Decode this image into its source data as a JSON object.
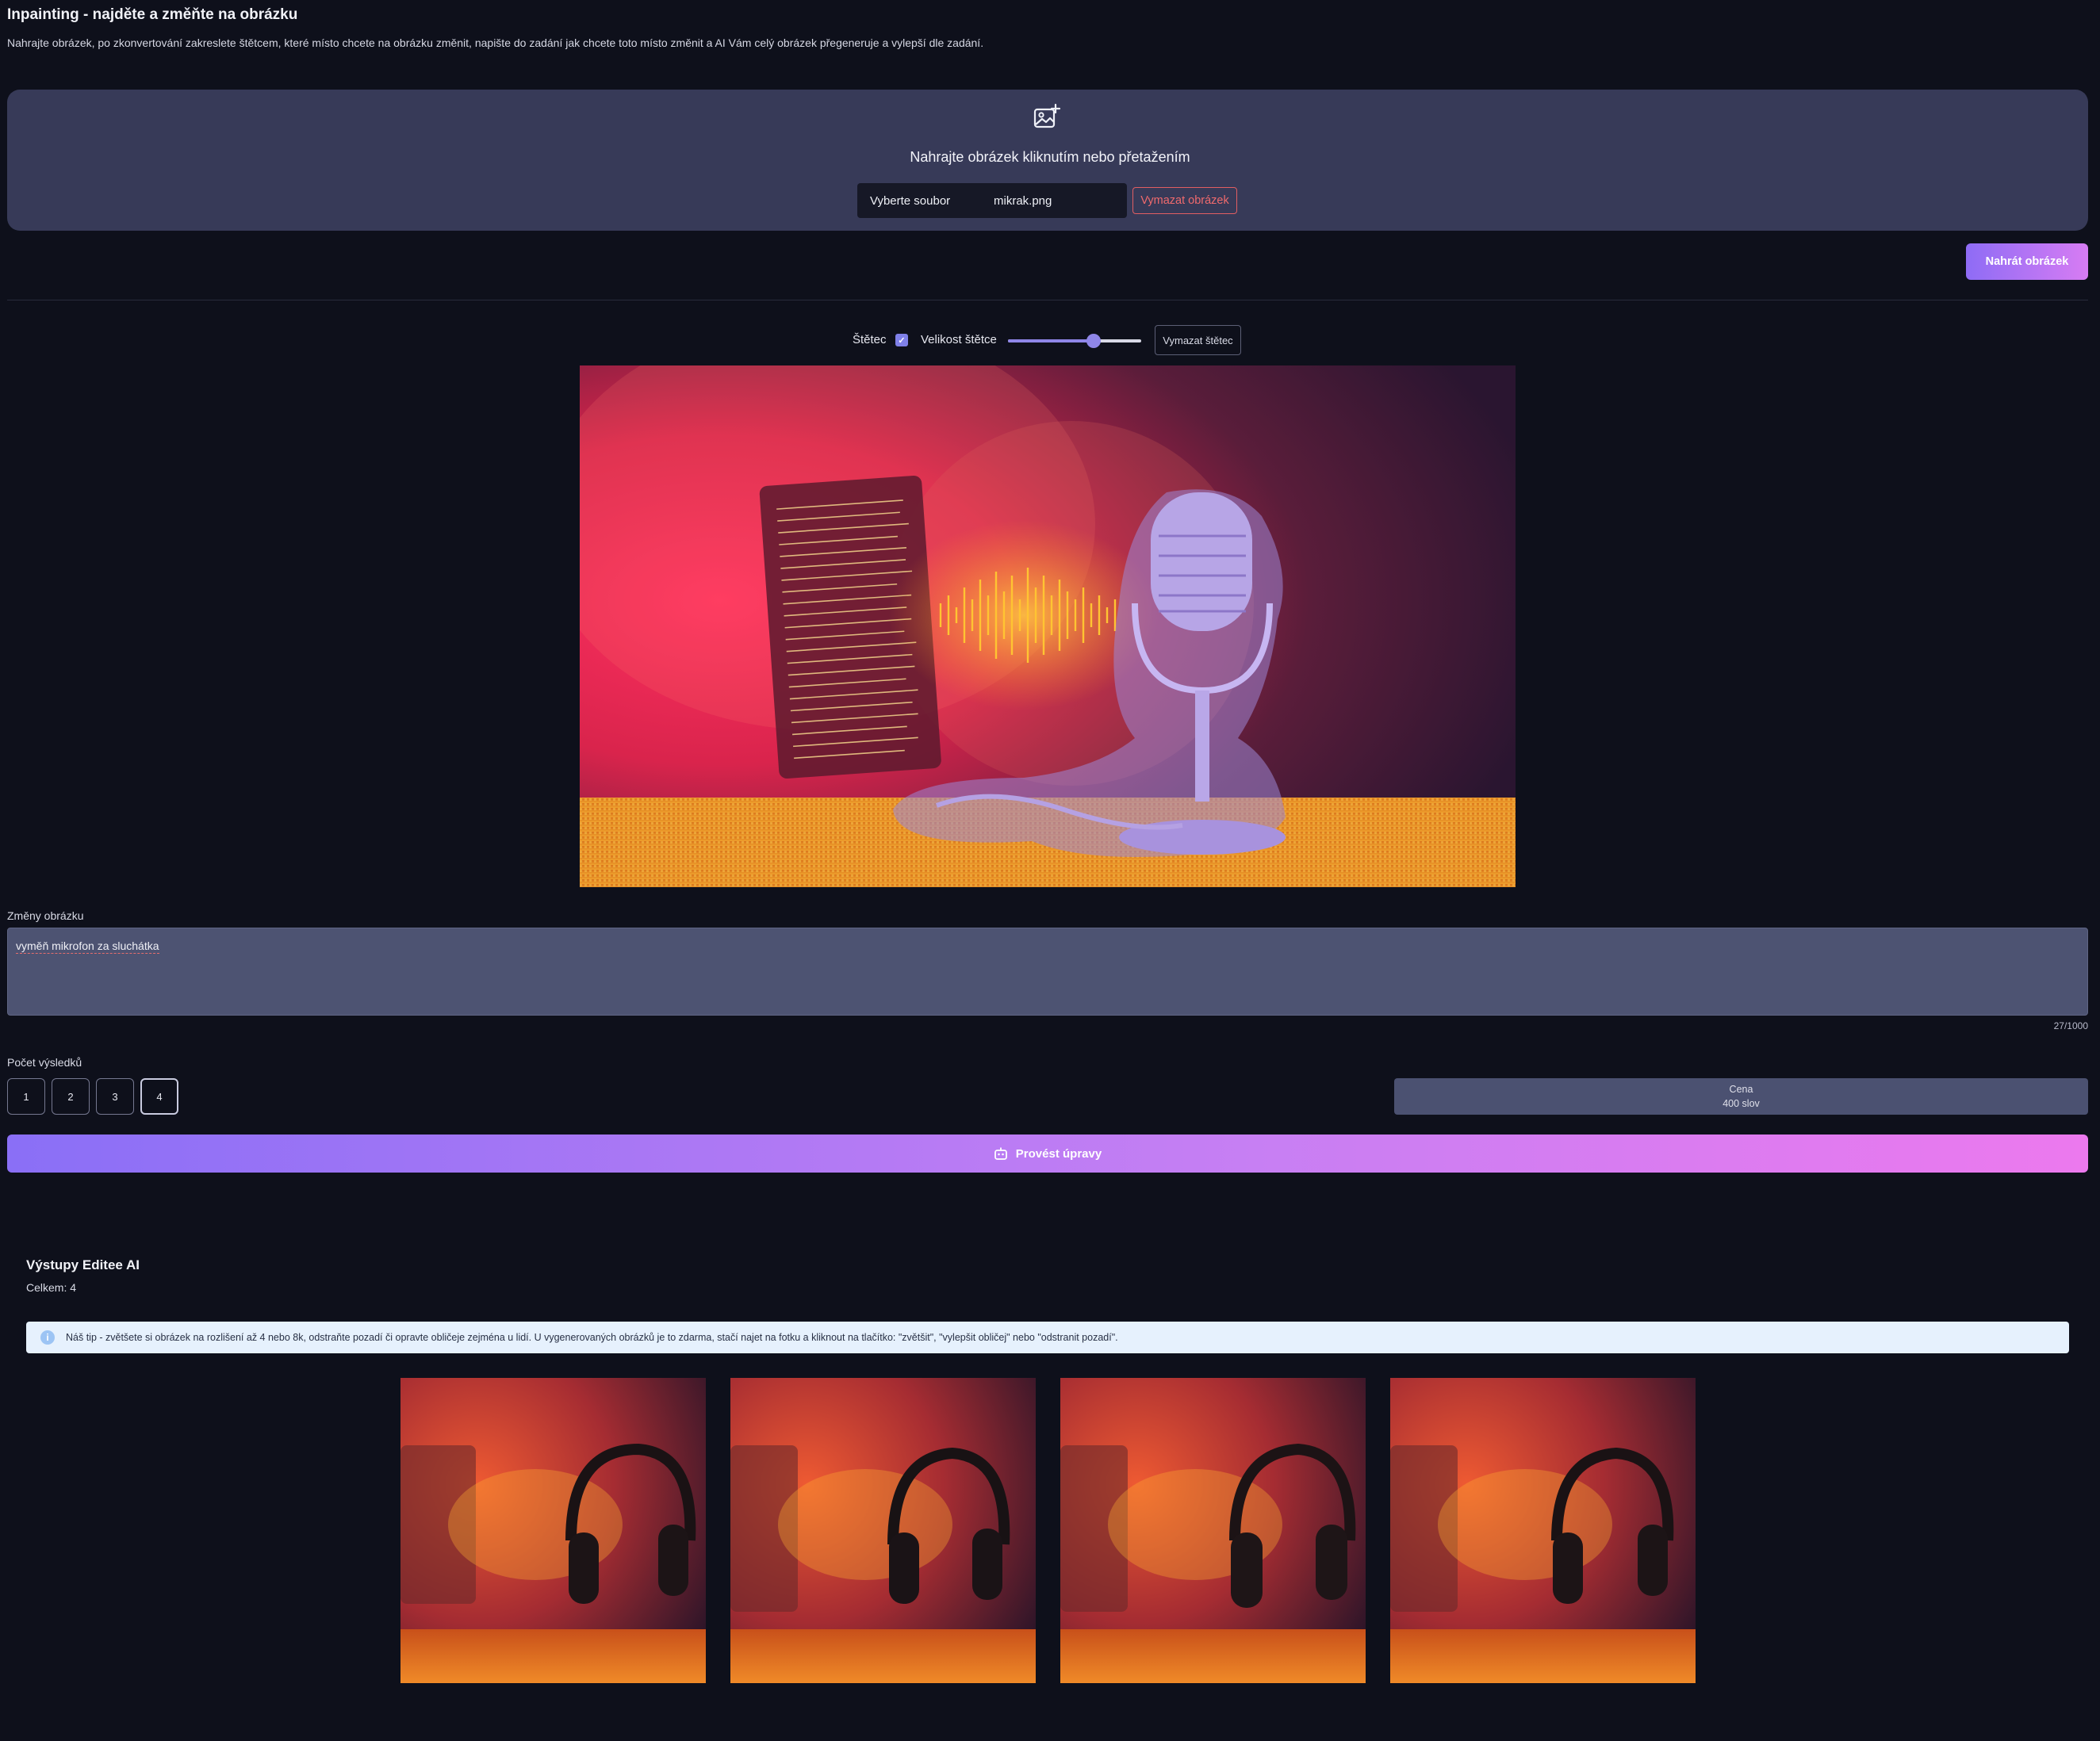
{
  "header": {
    "title": "Inpainting - najděte a změňte na obrázku",
    "description": "Nahrajte obrázek, po zkonvertování zakreslete štětcem, které místo chcete na obrázku změnit, napište do zadání jak chcete toto místo změnit a AI Vám celý obrázek přegeneruje a vylepší dle zadání."
  },
  "upload": {
    "prompt": "Nahrajte obrázek kliknutím nebo přetažením",
    "choose_file_label": "Vyberte soubor",
    "file_name": "mikrak.png",
    "clear_image_label": "Vymazat obrázek",
    "upload_button_label": "Nahrát obrázek"
  },
  "brush": {
    "brush_label": "Štětec",
    "brush_enabled": true,
    "size_label": "Velikost štětce",
    "size_value_fraction": 0.64,
    "clear_label": "Vymazat štětec"
  },
  "prompt": {
    "label": "Změny obrázku",
    "value": "vyměň mikrofon za sluchátka",
    "char_count": "27/1000"
  },
  "results": {
    "label": "Počet výsledků",
    "options": [
      "1",
      "2",
      "3",
      "4"
    ],
    "selected": "4",
    "price_label": "Cena",
    "price_value": "400 slov"
  },
  "submit": {
    "label": "Provést úpravy"
  },
  "outputs": {
    "title": "Výstupy Editee AI",
    "total": "Celkem: 4",
    "tip": "Náš tip - zvětšete si obrázek na rozlišení až 4 nebo 8k, odstraňte pozadí či opravte obličeje zejména u lidí. U vygenerovaných obrázků je to zdarma, stačí najet na fotku a kliknout na tlačítko: \"zvětšit\", \"vylepšit obličej\" nebo \"odstranit pozadí\"."
  },
  "colors": {
    "background": "#0e101b",
    "card": "#373a58",
    "accent_start": "#8a6ff6",
    "accent_end": "#ec79ee",
    "danger": "#e15e62"
  }
}
